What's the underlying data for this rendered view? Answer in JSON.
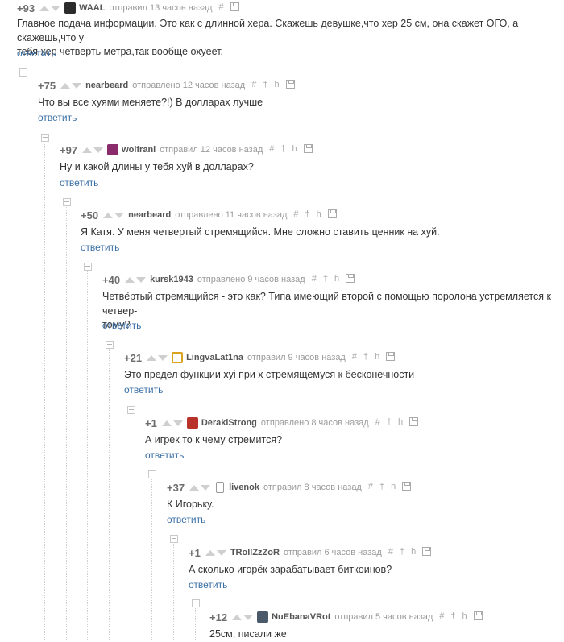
{
  "colors": {
    "link": "#3a6fa5",
    "rating": "#6d6d6d",
    "meta": "#8b8b8b"
  },
  "labels": {
    "reply": "ответить"
  },
  "comments": [
    {
      "rating": "+93",
      "author": "WAAL",
      "meta": "отправил 13 часов назад",
      "avatar_icon": "avatar-icon",
      "lines": [
        "Главное подача информации. Это как с длинной хера. Скажешь девушке,что хер 25 см, она скажет ОГО, а скажешь,что у",
        "тебя хер четверть метра,так вообще охуеет."
      ]
    },
    {
      "rating": "+75",
      "author": "nearbeard",
      "meta": "отправлено 12 часов назад",
      "lines": [
        "Что вы все хуями меняете?!) В долларах лучше"
      ]
    },
    {
      "rating": "+97",
      "author": "wolfrani",
      "meta": "отправил 12 часов назад",
      "avatar_icon": "avatar-icon",
      "lines": [
        "Ну и какой длины у тебя хуй в долларах?"
      ]
    },
    {
      "rating": "+50",
      "author": "nearbeard",
      "meta": "отправлено 11 часов назад",
      "lines": [
        "Я Катя. У меня четвертый стремящийся. Мне сложно ставить ценник на хуй."
      ]
    },
    {
      "rating": "+40",
      "author": "kursk1943",
      "meta": "отправлено 9 часов назад",
      "lines": [
        "Четвёртый стремящийся - это как? Типа имеющий второй с помощью поролона устремляется к четвер-",
        "тому?"
      ]
    },
    {
      "rating": "+21",
      "author": "LingvaLat1na",
      "meta": "отправил 9 часов назад",
      "avatar_icon": "avatar-icon",
      "lines": [
        "Это предел функции хуі при х стремящемуся к бесконечности"
      ]
    },
    {
      "rating": "+1",
      "author": "DeraklStrong",
      "meta": "отправлено 8 часов назад",
      "avatar_icon": "avatar-icon",
      "lines": [
        "А игрек то к чему стремится?"
      ]
    },
    {
      "rating": "+37",
      "author": "livenok",
      "meta": "отправил 8 часов назад",
      "avatar_icon": "avatar-icon",
      "lines": [
        "К Игорьку."
      ]
    },
    {
      "rating": "+1",
      "author": "TRollZzZoR",
      "meta": "отправил 6 часов назад",
      "lines": [
        "А сколько игорёк зарабатывает биткоинов?"
      ]
    },
    {
      "rating": "+12",
      "author": "NuEbanaVRot",
      "meta": "отправил 5 часов назад",
      "avatar_icon": "avatar-icon",
      "lines": [
        "25см, писали же"
      ]
    }
  ]
}
